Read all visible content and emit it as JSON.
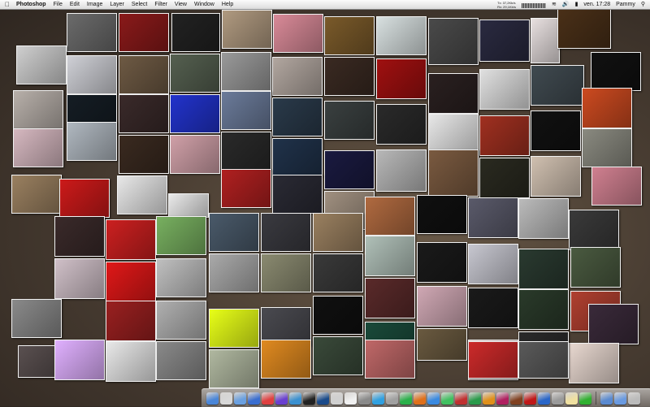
{
  "menubar": {
    "app_name": "Photoshop",
    "menus": [
      "File",
      "Edit",
      "Image",
      "Layer",
      "Select",
      "Filter",
      "View",
      "Window",
      "Help"
    ],
    "network_in": "Tx: 37,2Kb/s",
    "network_out": "Rx: 29,1Kb/s",
    "clock": "ven. 17:28",
    "user": "Pammy"
  },
  "desktop": {
    "photo_colors": [
      "#6b6b6b",
      "#8a1a1a",
      "#222222",
      "#b09a80",
      "#d98a98",
      "#7a5a2a",
      "#d8e0e0",
      "#4a4a4a",
      "#2a2a40",
      "#e8e0e0",
      "#4a3018",
      "#cfcfcf",
      "#cfd0d6",
      "#6e5a44",
      "#556050",
      "#9a9a9a",
      "#b2a7a0",
      "#3a2a22",
      "#a01010",
      "#2a2020",
      "#e0e0e0",
      "#404a50",
      "#111111",
      "#b8b0aa",
      "#151d24",
      "#3a2a2a",
      "#2233cc",
      "#6b7b9a",
      "#2a3a4a",
      "#3a4040",
      "#2a2a2a",
      "#e8e8e8",
      "#a03020",
      "#111111",
      "#cc4a20",
      "#d6b8c0",
      "#b0b8c0",
      "#3a2a20",
      "#d0a0a8",
      "#2a2a2a",
      "#20324a",
      "#1a1a40",
      "#b8b8b8",
      "#7a5a40",
      "#2a2a20",
      "#d0c0b0",
      "#8a8a80",
      "#9a8060",
      "#cc1a1a",
      "#e8e8e8",
      "#eaeaea",
      "#b02020",
      "#2a2a34",
      "#a09080",
      "#b06a40",
      "#101010",
      "#5a5a6a",
      "#bbbbbb",
      "#3a3a3a",
      "#d08090",
      "#3a2a2a",
      "#cc2020",
      "#78b060",
      "#4a5a6a",
      "#3a3a40",
      "#9a8060",
      "#b0c0b8",
      "#1a1a1a",
      "#c7c7d0",
      "#2a3a30",
      "#4a5a40",
      "#d0c0c8",
      "#e01818",
      "#c0c0c0",
      "#aaaaaa",
      "#8a8a70",
      "#3a3a3a",
      "#5a2a2a",
      "#d0a8b4",
      "#1a1a1a",
      "#2a3a2a",
      "#b04030",
      "#8a8a8a",
      "#9a2020",
      "#b0b0b0",
      "#e8ff18",
      "#4a4a50",
      "#101010",
      "#1a4a3a",
      "#6a5a40",
      "#e0d0d0",
      "#2a2a2a",
      "#3a2a3a",
      "#5a5050",
      "#e0b0ff",
      "#e8e8e8",
      "#8a8a8a",
      "#b0b8a0",
      "#e08a20",
      "#3a4a3a",
      "#c06868",
      "#e8d8d0",
      "#cc2a2a",
      "#5a5a5a",
      "#e8e8e8",
      "#9a9a9a"
    ]
  },
  "dock": {
    "items": [
      "finder-icon",
      "address-book-icon",
      "mail-icon",
      "safari-icon",
      "ical-icon",
      "itunes-icon",
      "iphoto-icon",
      "terminal-icon",
      "photoshop-icon",
      "preview-icon",
      "textedit-icon",
      "system-preferences-icon",
      "network-icon",
      "disk-utility-icon",
      "ichat-icon",
      "firefox-icon",
      "camino-icon",
      "adium-icon",
      "transmission-icon",
      "dreamweaver-icon",
      "illustrator-icon",
      "indesign-icon",
      "bridge-icon",
      "acrobat-icon",
      "quicktime-icon",
      "calculator-icon",
      "dictionary-icon",
      "activity-icon",
      "downloads-icon",
      "documents-icon",
      "trash-icon"
    ]
  }
}
